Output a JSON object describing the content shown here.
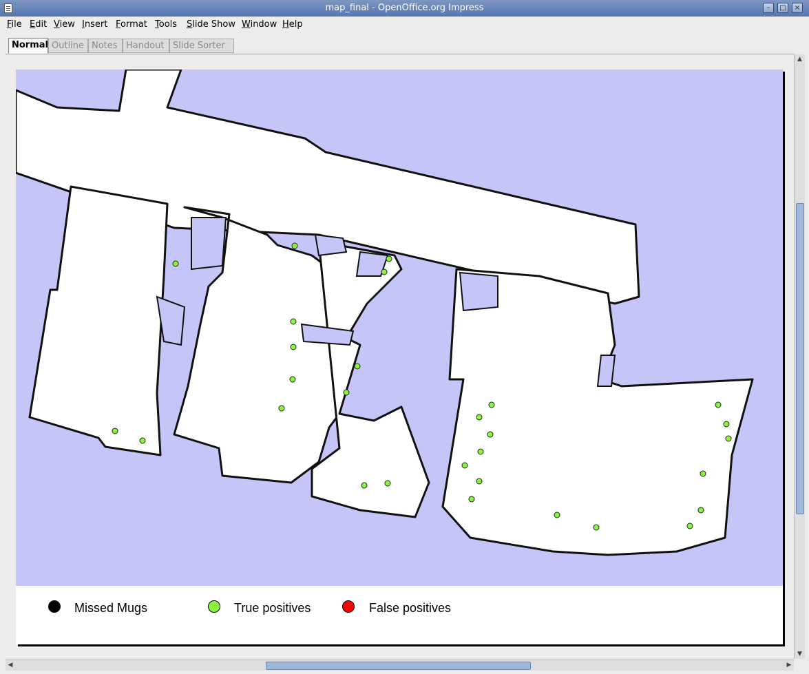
{
  "window": {
    "title": "map_final - OpenOffice.org Impress",
    "minimize_glyph": "–",
    "maximize_glyph": "□",
    "close_glyph": "×"
  },
  "menu": [
    "File",
    "Edit",
    "View",
    "Insert",
    "Format",
    "Tools",
    "Slide Show",
    "Window",
    "Help"
  ],
  "view_tabs": [
    "Normal",
    "Outline",
    "Notes",
    "Handout",
    "Slide Sorter"
  ],
  "active_tab": "Normal",
  "colors": {
    "map_background": "#c5c5f7",
    "free_space": "#ffffff",
    "walls": "#111111",
    "true_positive": "#8cf43c",
    "false_positive": "#ff0000",
    "missed": "#000000"
  },
  "legend": {
    "missed_label": "Missed Mugs",
    "true_positive_label": "True positives",
    "false_positive_label": "False positives"
  },
  "icons": {
    "scroll_up": "▲",
    "scroll_down": "▼",
    "scroll_left": "◀",
    "scroll_right": "▶"
  }
}
